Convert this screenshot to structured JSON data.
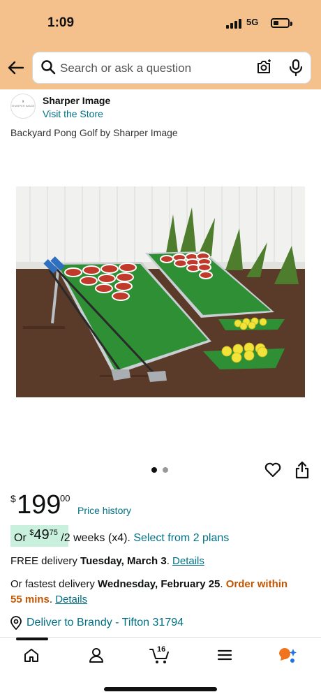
{
  "status": {
    "time": "1:09",
    "network": "5G"
  },
  "search": {
    "placeholder": "Search or ask a question"
  },
  "brand": {
    "name": "Sharper Image",
    "visit_store": "Visit the Store",
    "logo_text": "SHARPER IMAGE"
  },
  "product": {
    "title": "Backyard Pong Golf by Sharper Image"
  },
  "carousel": {
    "active_index": 0,
    "count": 2
  },
  "price": {
    "symbol": "$",
    "whole": "199",
    "fraction": "00",
    "history_link": "Price history"
  },
  "installment": {
    "prefix": "Or ",
    "symbol": "$",
    "whole": "49",
    "fraction": "75",
    "period": " /2 weeks (x4). ",
    "plans_link": "Select from 2 plans"
  },
  "delivery": {
    "free_prefix": "FREE delivery ",
    "free_date": "Tuesday, March 3",
    "details_link": "Details",
    "fast_prefix": "Or fastest delivery ",
    "fast_date": "Wednesday, February 25",
    "order_within": "Order within",
    "order_time": "55 mins",
    "fast_details_link": "Details"
  },
  "location": {
    "text": "Deliver to Brandy - Tifton 31794"
  },
  "nav": {
    "cart_count": "16"
  },
  "colors": {
    "header": "#f4c08b",
    "link": "#007185",
    "urgent": "#c45500",
    "badge": "#c8f0dd"
  }
}
